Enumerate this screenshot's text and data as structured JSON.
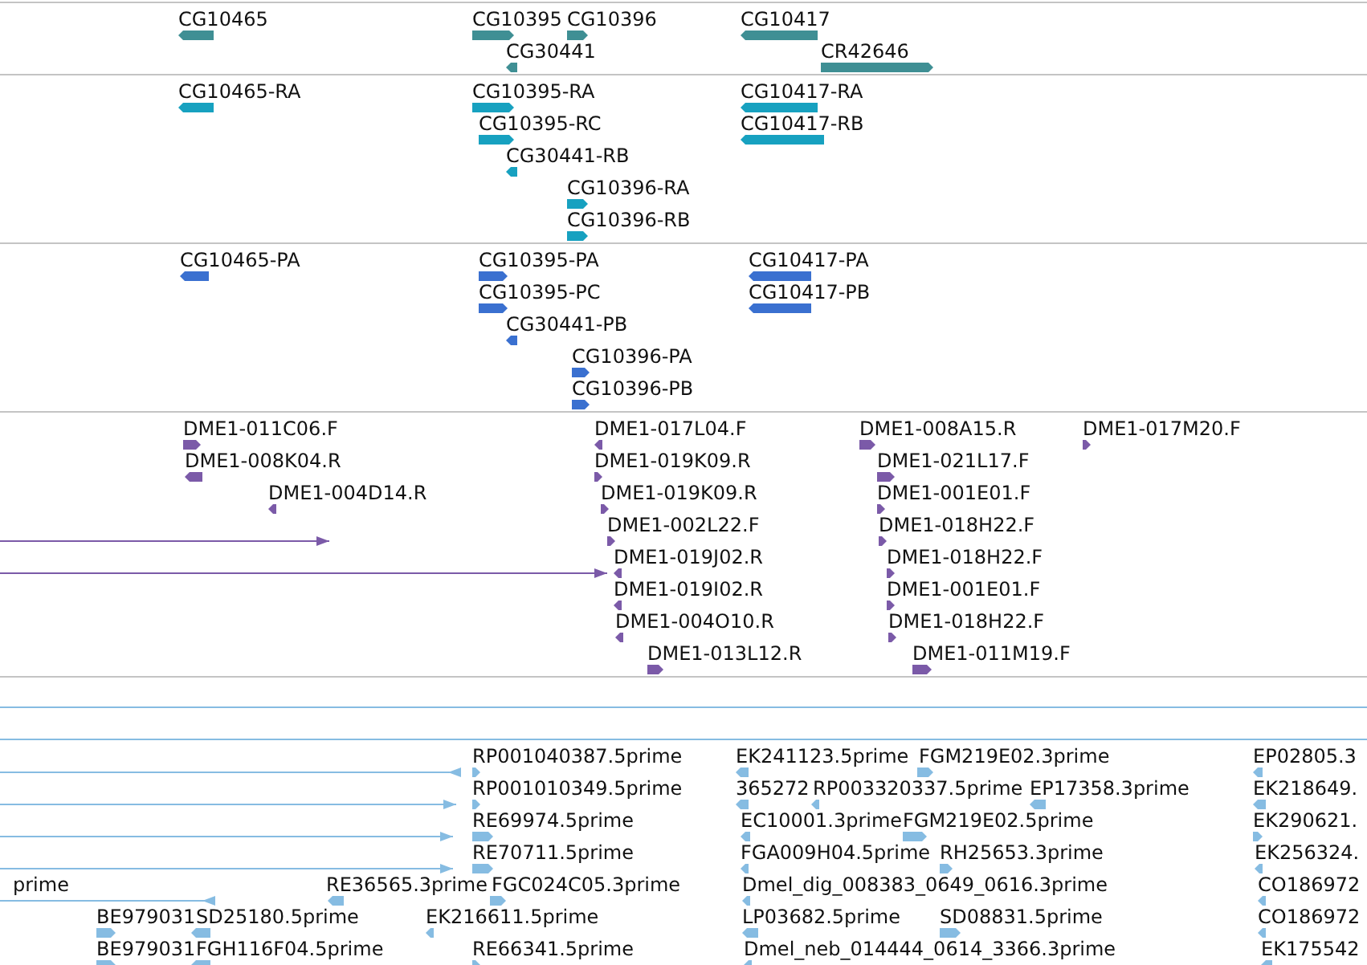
{
  "tracks": [
    {
      "color": "#3f8f94",
      "features": [
        {
          "label": "CG10465",
          "reverse": true
        },
        {
          "label": "CG10395",
          "reverse": false
        },
        {
          "label": "CG10396",
          "reverse": false
        },
        {
          "label": "CG30441",
          "reverse": true
        },
        {
          "label": "CG10417",
          "reverse": true
        },
        {
          "label": "CR42646",
          "reverse": false
        }
      ]
    },
    {
      "color": "#17a1c0",
      "features": [
        {
          "label": "CG10465-RA",
          "reverse": true
        },
        {
          "label": "CG10395-RA",
          "reverse": false
        },
        {
          "label": "CG10395-RC",
          "reverse": false
        },
        {
          "label": "CG30441-RB",
          "reverse": true
        },
        {
          "label": "CG10396-RA",
          "reverse": false
        },
        {
          "label": "CG10396-RB",
          "reverse": false
        },
        {
          "label": "CG10417-RA",
          "reverse": true
        },
        {
          "label": "CG10417-RB",
          "reverse": true
        }
      ]
    },
    {
      "color": "#3a70d0",
      "features": [
        {
          "label": "CG10465-PA",
          "reverse": true
        },
        {
          "label": "CG10395-PA",
          "reverse": false
        },
        {
          "label": "CG10395-PC",
          "reverse": false
        },
        {
          "label": "CG30441-PB",
          "reverse": true
        },
        {
          "label": "CG10396-PA",
          "reverse": false
        },
        {
          "label": "CG10396-PB",
          "reverse": false
        },
        {
          "label": "CG10417-PA",
          "reverse": true
        },
        {
          "label": "CG10417-PB",
          "reverse": true
        }
      ]
    },
    {
      "color": "#7b5aa8",
      "features": [
        {
          "label": "DME1-011C06.F",
          "reverse": false
        },
        {
          "label": "DME1-008K04.R",
          "reverse": true
        },
        {
          "label": "DME1-004D14.R",
          "reverse": true
        },
        {
          "reverse": false
        },
        {
          "reverse": false
        },
        {
          "label": "DME1-017L04.F",
          "reverse": true
        },
        {
          "label": "DME1-019K09.R",
          "reverse": false
        },
        {
          "label": "DME1-019K09.R",
          "reverse": false
        },
        {
          "label": "DME1-002L22.F",
          "reverse": false
        },
        {
          "label": "DME1-019J02.R",
          "reverse": true
        },
        {
          "label": "DME1-019I02.R",
          "reverse": true
        },
        {
          "label": "DME1-004O10.R",
          "reverse": true
        },
        {
          "label": "DME1-013L12.R",
          "reverse": false
        },
        {
          "label": "DME1-008A15.R",
          "reverse": false
        },
        {
          "label": "DME1-021L17.F",
          "reverse": false
        },
        {
          "label": "DME1-001E01.F",
          "reverse": false
        },
        {
          "label": "DME1-018H22.F",
          "reverse": false
        },
        {
          "label": "DME1-018H22.F",
          "reverse": false
        },
        {
          "label": "DME1-001E01.F",
          "reverse": false
        },
        {
          "label": "DME1-018H22.F",
          "reverse": false
        },
        {
          "label": "DME1-011M19.F",
          "reverse": false
        },
        {
          "label": "DME1-017M20.F",
          "reverse": false
        }
      ]
    },
    {
      "color": "#86bce2",
      "features": [
        {
          "reverse": true
        },
        {
          "reverse": false
        },
        {
          "reverse": false
        },
        {
          "reverse": false
        },
        {
          "label": "prime",
          "reverse": true
        },
        {
          "label": "RP001040387.5prime",
          "reverse": false
        },
        {
          "label": "RP001010349.5prime",
          "reverse": false
        },
        {
          "label": "RE69974.5prime",
          "reverse": false
        },
        {
          "label": "RE70711.5prime",
          "reverse": false
        },
        {
          "label": "RE36565.3prime",
          "reverse": true
        },
        {
          "label": "FGC024C05.3prime",
          "reverse": false
        },
        {
          "label": "BE979031",
          "reverse": false
        },
        {
          "label": "SD25180.5prime",
          "reverse": true
        },
        {
          "label": "BE979031",
          "reverse": false
        },
        {
          "label": "FGH116F04.5prime",
          "reverse": true
        },
        {
          "label": "EK216611.5prime",
          "reverse": true
        },
        {
          "label": "RE66341.5prime",
          "reverse": false
        },
        {
          "label": "EK241123.5prime",
          "reverse": true
        },
        {
          "label": "FGM219E02.3prime",
          "reverse": false
        },
        {
          "label": "365272",
          "reverse": true
        },
        {
          "label": "RP003320337.5prime",
          "reverse": true
        },
        {
          "label": "EP17358.3prime",
          "reverse": true
        },
        {
          "label": "EC10001.3prime",
          "reverse": true
        },
        {
          "label": "FGM219E02.5prime",
          "reverse": false
        },
        {
          "label": "FGA009H04.5prime",
          "reverse": true
        },
        {
          "label": "RH25653.3prime",
          "reverse": false
        },
        {
          "label": "Dmel_dig_008383_0649_0616.3prime",
          "reverse": true
        },
        {
          "label": "LP03682.5prime",
          "reverse": true
        },
        {
          "label": "SD08831.5prime",
          "reverse": false
        },
        {
          "label": "Dmel_neb_014444_0614_3366.3prime",
          "reverse": true
        },
        {
          "label": "EP02805.3",
          "reverse": true
        },
        {
          "label": "EK218649.",
          "reverse": true
        },
        {
          "label": "EK290621.",
          "reverse": false
        },
        {
          "label": "EK256324.",
          "reverse": true
        },
        {
          "label": "CO186972",
          "reverse": true
        },
        {
          "label": "CO186972",
          "reverse": true
        },
        {
          "label": "EK175542",
          "reverse": true
        }
      ]
    }
  ]
}
